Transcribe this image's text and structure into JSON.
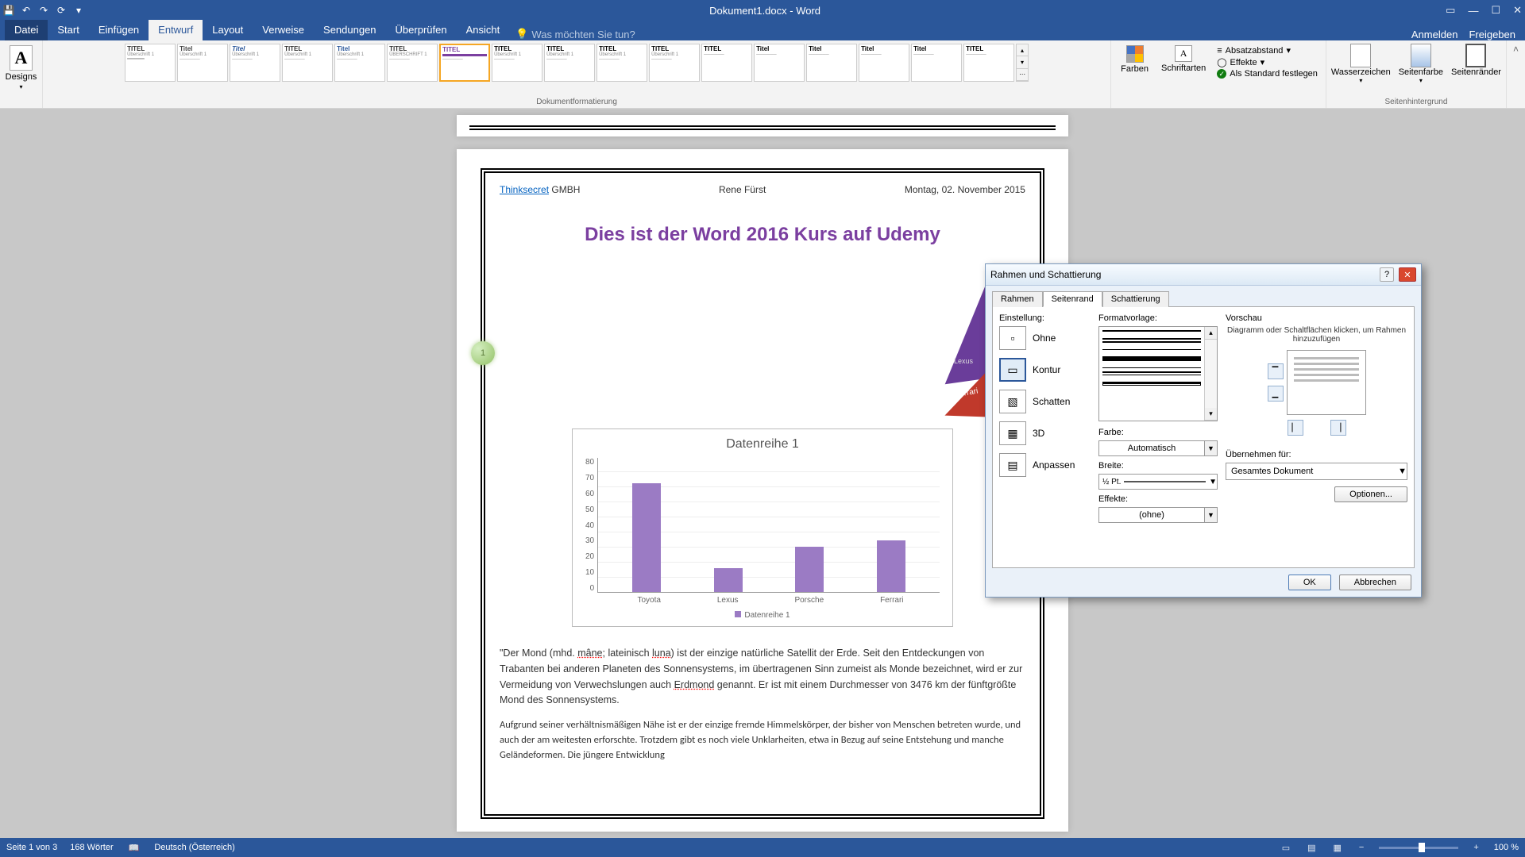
{
  "titlebar": {
    "title": "Dokument1.docx - Word"
  },
  "menu": {
    "tabs": [
      "Datei",
      "Start",
      "Einfügen",
      "Entwurf",
      "Layout",
      "Verweise",
      "Sendungen",
      "Überprüfen",
      "Ansicht"
    ],
    "active": "Entwurf",
    "tellme": "Was möchten Sie tun?",
    "signin": "Anmelden",
    "share": "Freigeben"
  },
  "ribbon": {
    "designs": "Designs",
    "group_format": "Dokumentformatierung",
    "group_pagebg": "Seitenhintergrund",
    "colors": "Farben",
    "fonts": "Schriftarten",
    "spacing": "Absatzabstand",
    "effects": "Effekte",
    "setdefault": "Als Standard festlegen",
    "watermark": "Wasserzeichen",
    "pagecolor": "Seitenfarbe",
    "pageborders": "Seitenränder"
  },
  "doc": {
    "head_left_link": "Thinksecret",
    "head_left_rest": " GMBH",
    "head_mid": "Rene Fürst",
    "head_right": "Montag, 02. November 2015",
    "title": "Dies ist der Word 2016 Kurs auf Udemy",
    "body1_a": "\"Der Mond (mhd. ",
    "body1_link1": "mâne",
    "body1_b": "; lateinisch ",
    "body1_link2": "luna",
    "body1_c": ") ist der einzige natürliche Satellit der Erde. Seit den Entdeckungen von Trabanten bei anderen Planeten des Sonnensystems, im übertragenen Sinn zumeist als Monde bezeichnet, wird er zur Vermeidung von Verwechslungen auch ",
    "body1_link3": "Erdmond",
    "body1_d": " genannt. Er ist mit einem Durchmesser von 3476 km der fünftgrößte Mond des Sonnensystems.",
    "body2": "Aufgrund seiner verhältnismäßigen Nähe ist er der einzige fremde Himmelskörper, der bisher von Menschen betreten wurde, und auch der am weitesten erforschte. Trotzdem gibt es noch viele Unklarheiten, etwa in Bezug auf seine Entstehung und manche Geländeformen. Die jüngere Entwicklung"
  },
  "chart_data": {
    "type": "bar",
    "title": "Datenreihe 1",
    "categories": [
      "Toyota",
      "Lexus",
      "Porsche",
      "Ferrari"
    ],
    "values": [
      65,
      14,
      27,
      31
    ],
    "ylim": [
      0,
      80
    ],
    "yticks": [
      0,
      10,
      20,
      30,
      40,
      50,
      60,
      70,
      80
    ],
    "legend": "Datenreihe 1"
  },
  "dialog": {
    "title": "Rahmen und Schattierung",
    "tabs": [
      "Rahmen",
      "Seitenrand",
      "Schattierung"
    ],
    "activeTab": "Seitenrand",
    "setting_label": "Einstellung:",
    "settings": {
      "none": "Ohne",
      "box": "Kontur",
      "shadow": "Schatten",
      "threed": "3D",
      "custom": "Anpassen"
    },
    "style_label": "Formatvorlage:",
    "color_label": "Farbe:",
    "color_value": "Automatisch",
    "width_label": "Breite:",
    "width_value": "½ Pt.",
    "art_label": "Effekte:",
    "art_value": "(ohne)",
    "preview_label": "Vorschau",
    "preview_hint": "Diagramm oder Schaltflächen klicken, um Rahmen hinzuzufügen",
    "apply_label": "Übernehmen für:",
    "apply_value": "Gesamtes Dokument",
    "options": "Optionen...",
    "ok": "OK",
    "cancel": "Abbrechen"
  },
  "status": {
    "page": "Seite 1 von 3",
    "words": "168 Wörter",
    "lang": "Deutsch (Österreich)",
    "zoom": "100 %"
  }
}
